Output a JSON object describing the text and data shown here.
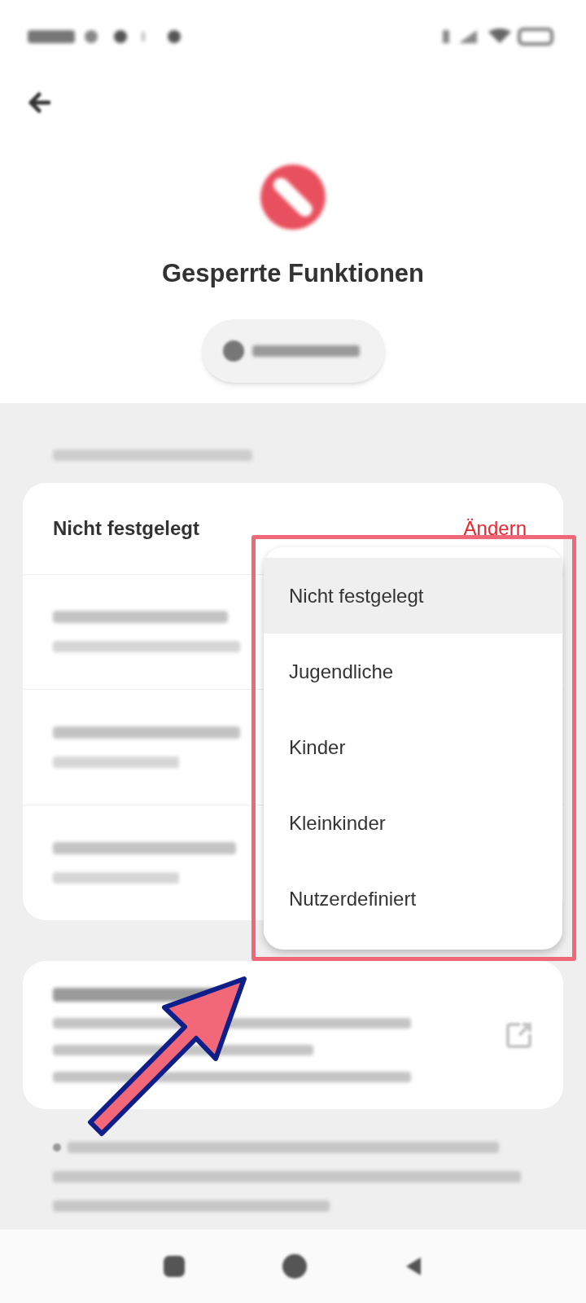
{
  "header": {
    "title": "Gesperrte Funktionen"
  },
  "category_card": {
    "value": "Nicht festgelegt",
    "action": "Ändern"
  },
  "menu": {
    "items": [
      {
        "label": "Nicht festgelegt",
        "selected": true
      },
      {
        "label": "Jugendliche",
        "selected": false
      },
      {
        "label": "Kinder",
        "selected": false
      },
      {
        "label": "Kleinkinder",
        "selected": false
      },
      {
        "label": "Nutzerdefiniert",
        "selected": false
      }
    ]
  }
}
